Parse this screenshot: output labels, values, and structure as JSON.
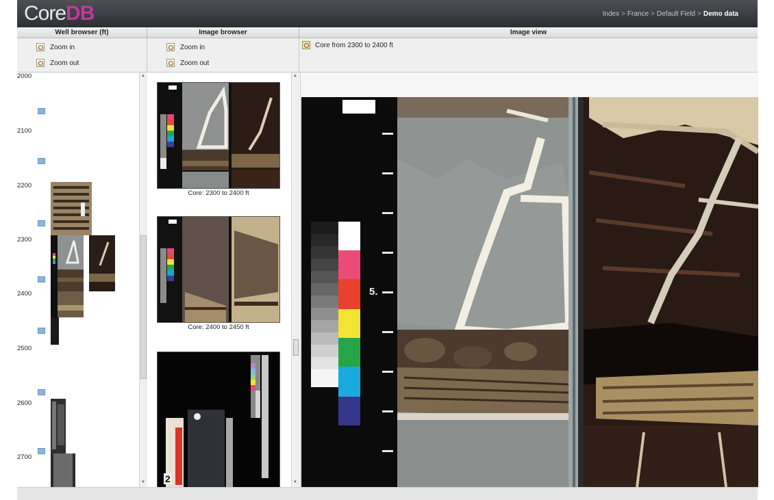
{
  "app": {
    "logo_core": "Core",
    "logo_db": "DB"
  },
  "breadcrumb": [
    {
      "label": "Index"
    },
    {
      "label": "France"
    },
    {
      "label": "Default Field"
    },
    {
      "label": "Demo data"
    }
  ],
  "breadcrumb_sep": ">",
  "panels": {
    "well": {
      "title": "Well browser (ft)",
      "zoom_in": "Zoom in",
      "zoom_out": "Zoom out"
    },
    "image": {
      "title": "Image browser",
      "zoom_in": "Zoom in",
      "zoom_out": "Zoom out"
    },
    "view": {
      "title": "Image view",
      "current": "Core from 2300 to 2400 ft"
    }
  },
  "depths": [
    "2000",
    "2100",
    "2200",
    "2300",
    "2400",
    "2500",
    "2600",
    "2700"
  ],
  "thumbnails": [
    {
      "caption": "Core: 2300 to 2400 ft"
    },
    {
      "caption": "Core: 2400 to 2450 ft"
    }
  ],
  "scale_label": "5.",
  "ruler_label": "2",
  "colors": {
    "accent": "#c13a9b",
    "header_dark": "#2c2f33",
    "marker": "#8fb3dc"
  },
  "icons": [
    "zoom-in-icon",
    "zoom-out-icon",
    "image-icon",
    "depth-marker-icon"
  ]
}
